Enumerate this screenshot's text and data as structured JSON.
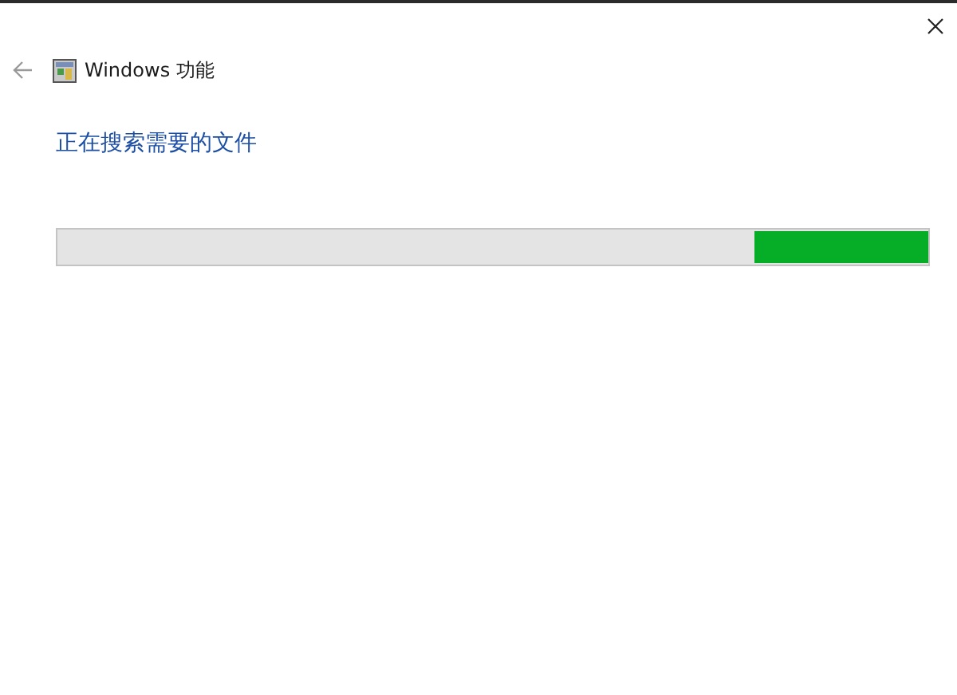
{
  "window": {
    "title": "Windows 功能"
  },
  "status": {
    "heading": "正在搜索需要的文件"
  },
  "progress": {
    "kind": "marquee",
    "level": 0.2
  }
}
